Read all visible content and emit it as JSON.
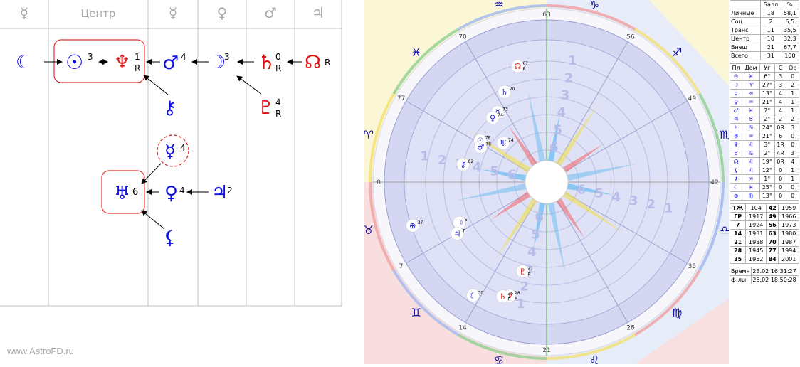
{
  "watermark": "www.AstroFD.ru",
  "left_panel": {
    "columns": [
      {
        "label": "☿",
        "type": "glyph"
      },
      {
        "label": "Центр",
        "type": "text"
      },
      {
        "label": "☿",
        "type": "glyph"
      },
      {
        "label": "♀",
        "type": "glyph"
      },
      {
        "label": "♂",
        "type": "glyph"
      },
      {
        "label": "♃",
        "type": "glyph"
      }
    ],
    "nodes": [
      {
        "id": "moon_l",
        "glyph": "☾",
        "sup": ""
      },
      {
        "id": "sun",
        "glyph": "☉",
        "sup": "3"
      },
      {
        "id": "neptune",
        "glyph": "♆",
        "sup": "1",
        "sub": "R"
      },
      {
        "id": "mars",
        "glyph": "♂",
        "sup": "4"
      },
      {
        "id": "moon",
        "glyph": "☽",
        "sup": "3"
      },
      {
        "id": "saturn",
        "glyph": "♄",
        "sup": "0",
        "sub": "R"
      },
      {
        "id": "node",
        "glyph": "☊",
        "sup": "R"
      },
      {
        "id": "chiron",
        "glyph": "⚷",
        "sup": ""
      },
      {
        "id": "pluto",
        "glyph": "♇",
        "sup": "4",
        "sub": "R"
      },
      {
        "id": "mercury",
        "glyph": "☿",
        "sup": "4"
      },
      {
        "id": "uranus",
        "glyph": "♅",
        "sup": "6"
      },
      {
        "id": "venus",
        "glyph": "♀",
        "sup": "4"
      },
      {
        "id": "jupiter",
        "glyph": "♃",
        "sup": "2"
      },
      {
        "id": "lilith",
        "glyph": "⚸",
        "sup": ""
      }
    ]
  },
  "chart": {
    "outer_numbers": [
      "63",
      "56",
      "49",
      "42",
      "35",
      "28",
      "21",
      "14",
      "7",
      "0",
      "77",
      "70"
    ],
    "zodiac": [
      "♑",
      "♐",
      "♏",
      "♎",
      "♍",
      "♌",
      "♋",
      "♊",
      "♉",
      "♈",
      "♓",
      "♒"
    ],
    "inner_numbers": [
      "1",
      "2",
      "3",
      "4",
      "5",
      "6"
    ],
    "planets": [
      {
        "glyph": "☊",
        "label": "67",
        "sub": "R",
        "color": "#e01010"
      },
      {
        "glyph": "♄",
        "label": "70",
        "color": "#1010e0"
      },
      {
        "glyph": "☿",
        "label": "73",
        "color": "#1010e0"
      },
      {
        "glyph": "♀",
        "label": "74",
        "color": "#1010e0"
      },
      {
        "glyph": "☉",
        "label": "78",
        "color": "#1010e0"
      },
      {
        "glyph": "♂",
        "label": "78",
        "color": "#1010e0"
      },
      {
        "glyph": "♅",
        "label": "74",
        "color": "#1010e0"
      },
      {
        "glyph": "⚷",
        "label": "82",
        "color": "#1010e0"
      },
      {
        "glyph": "☽",
        "label": "6",
        "color": "#1010e0"
      },
      {
        "glyph": "♃",
        "label": "7",
        "color": "#1010e0"
      },
      {
        "glyph": "♇",
        "label": "21",
        "sub": "R",
        "color": "#e01010"
      },
      {
        "glyph": "♆",
        "label": "28",
        "sub": "R",
        "color": "#e01010"
      },
      {
        "glyph": "☾",
        "label": "30",
        "color": "#1010e0"
      },
      {
        "glyph": "♄",
        "label": "26",
        "sub": "R",
        "color": "#e01010"
      },
      {
        "glyph": "⊕",
        "label": "37",
        "color": "#1010e0"
      }
    ]
  },
  "table_scores": {
    "header": [
      "",
      "Балл",
      "%"
    ],
    "rows": [
      [
        "Личные",
        "18",
        "58,1"
      ],
      [
        "Соц",
        "2",
        "6,5"
      ],
      [
        "Транс",
        "11",
        "35,5"
      ],
      [
        "Центр",
        "10",
        "32,3"
      ],
      [
        "Внеш",
        "21",
        "67,7"
      ],
      [
        "Всего",
        "31",
        "100"
      ]
    ]
  },
  "table_planets": {
    "header": [
      "Пл",
      "Дом",
      "Уг",
      "С",
      "Ор"
    ],
    "rows": [
      [
        "☉",
        "♓",
        "6°",
        "3",
        "0"
      ],
      [
        "☽",
        "♈",
        "27°",
        "3",
        "2"
      ],
      [
        "☿",
        "♒",
        "13°",
        "4",
        "1"
      ],
      [
        "♀",
        "♒",
        "21°",
        "4",
        "1"
      ],
      [
        "♂",
        "♓",
        "7°",
        "4",
        "1"
      ],
      [
        "♃",
        "♉",
        "2°",
        "2",
        "2"
      ],
      [
        "♄",
        "♋",
        "24°",
        "0R",
        "3"
      ],
      [
        "♅",
        "♒",
        "21°",
        "6",
        "0"
      ],
      [
        "♆",
        "♌",
        "3°",
        "1R",
        "0"
      ],
      [
        "♇",
        "♋",
        "2°",
        "4R",
        "3"
      ],
      [
        "☊",
        "♌",
        "19°",
        "0R",
        "4"
      ],
      [
        "⚸",
        "♌",
        "12°",
        "0",
        "1"
      ],
      [
        "⚷",
        "♒",
        "1°",
        "0",
        "1"
      ],
      [
        "☾",
        "♓",
        "25°",
        "0",
        "0"
      ],
      [
        "⊕",
        "♍",
        "13°",
        "0",
        "0"
      ]
    ]
  },
  "table_years": {
    "rows": [
      [
        "ТЖ",
        "104",
        "42",
        "1959"
      ],
      [
        "ГР",
        "1917",
        "49",
        "1966"
      ],
      [
        "7",
        "1924",
        "56",
        "1973"
      ],
      [
        "14",
        "1931",
        "63",
        "1980"
      ],
      [
        "21",
        "1938",
        "70",
        "1987"
      ],
      [
        "28",
        "1945",
        "77",
        "1994"
      ],
      [
        "35",
        "1952",
        "84",
        "2001"
      ]
    ]
  },
  "table_time": {
    "rows": [
      [
        "Время",
        "23.02 16:31:27"
      ],
      [
        "ф-лы",
        "25.02 18:50:28"
      ]
    ]
  }
}
